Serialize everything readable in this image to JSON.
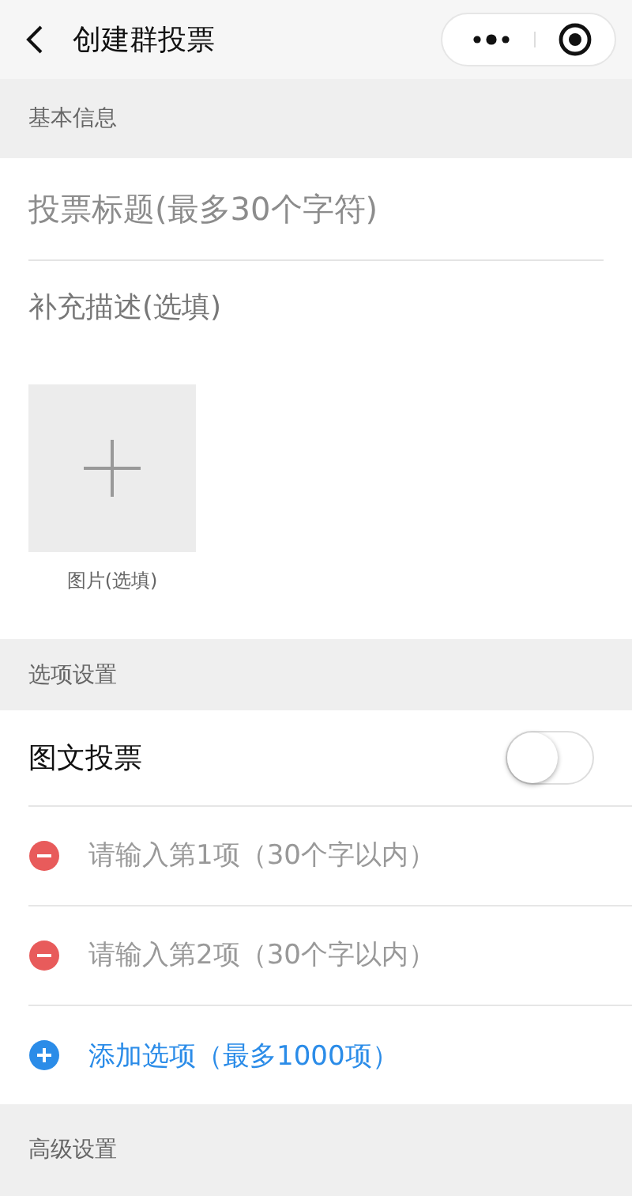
{
  "nav": {
    "title": "创建群投票"
  },
  "basic": {
    "header": "基本信息",
    "title_placeholder": "投票标题(最多30个字符)",
    "desc_placeholder": "补充描述(选填)",
    "image_label": "图片(选填)"
  },
  "options": {
    "header": "选项设置",
    "toggle": {
      "label": "图文投票",
      "on": false
    },
    "items": [
      {
        "placeholder": "请输入第1项（30个字以内）"
      },
      {
        "placeholder": "请输入第2项（30个字以内）"
      }
    ],
    "add": "添加选项（最多1000项）"
  },
  "advanced": {
    "header": "高级设置"
  }
}
